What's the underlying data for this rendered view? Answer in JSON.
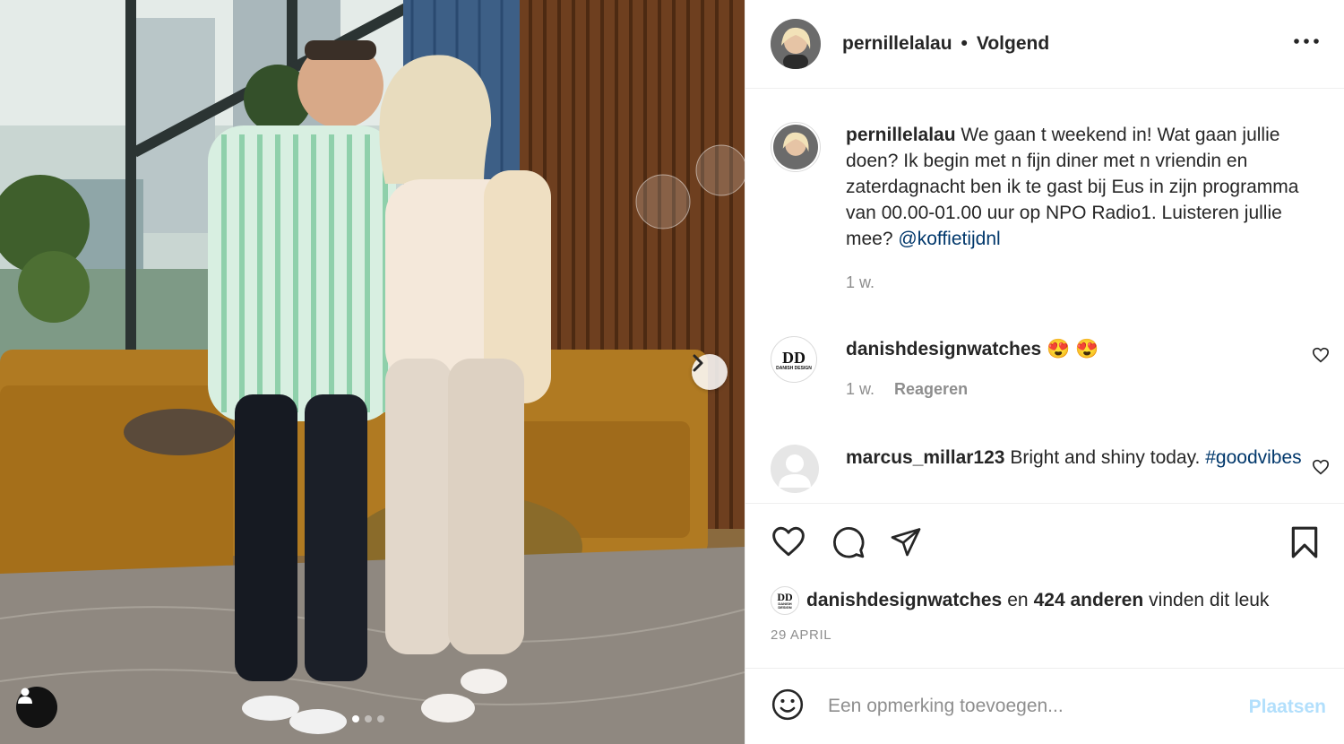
{
  "post": {
    "username": "pernillelalau",
    "separator": "•",
    "follow_label": "Volgend",
    "caption": "We gaan t weekend in! Wat gaan jullie doen? Ik begin met n fijn diner met n vriendin en zaterdagnacht ben ik te gast bij Eus in zijn programma van 00.00-01.00 uur op NPO Radio1. Luisteren jullie mee?",
    "caption_mention": "@koffietijdnl",
    "caption_time": "1 w.",
    "carousel": {
      "slide_count": 3,
      "active_index": 0
    }
  },
  "comments": [
    {
      "username": "danishdesignwatches",
      "text": "😍 😍",
      "time": "1 w.",
      "reply_label": "Reageren",
      "avatar_text": "DD",
      "avatar_subtext": "DANISH DESIGN"
    },
    {
      "username": "marcus_millar123",
      "text": "Bright and shiny today.",
      "hashtag": "#goodvibes"
    }
  ],
  "likes": {
    "first_user": "danishdesignwatches",
    "joiner": "en",
    "others": "424 anderen",
    "suffix": "vinden dit leuk"
  },
  "date": "29 APRIL",
  "comment_box": {
    "placeholder": "Een opmerking toevoegen...",
    "post_label": "Plaatsen"
  },
  "colors": {
    "link": "#00376b",
    "post_disabled": "#b2dffc",
    "secondary_text": "#8e8e8e",
    "divider": "#efefef"
  }
}
